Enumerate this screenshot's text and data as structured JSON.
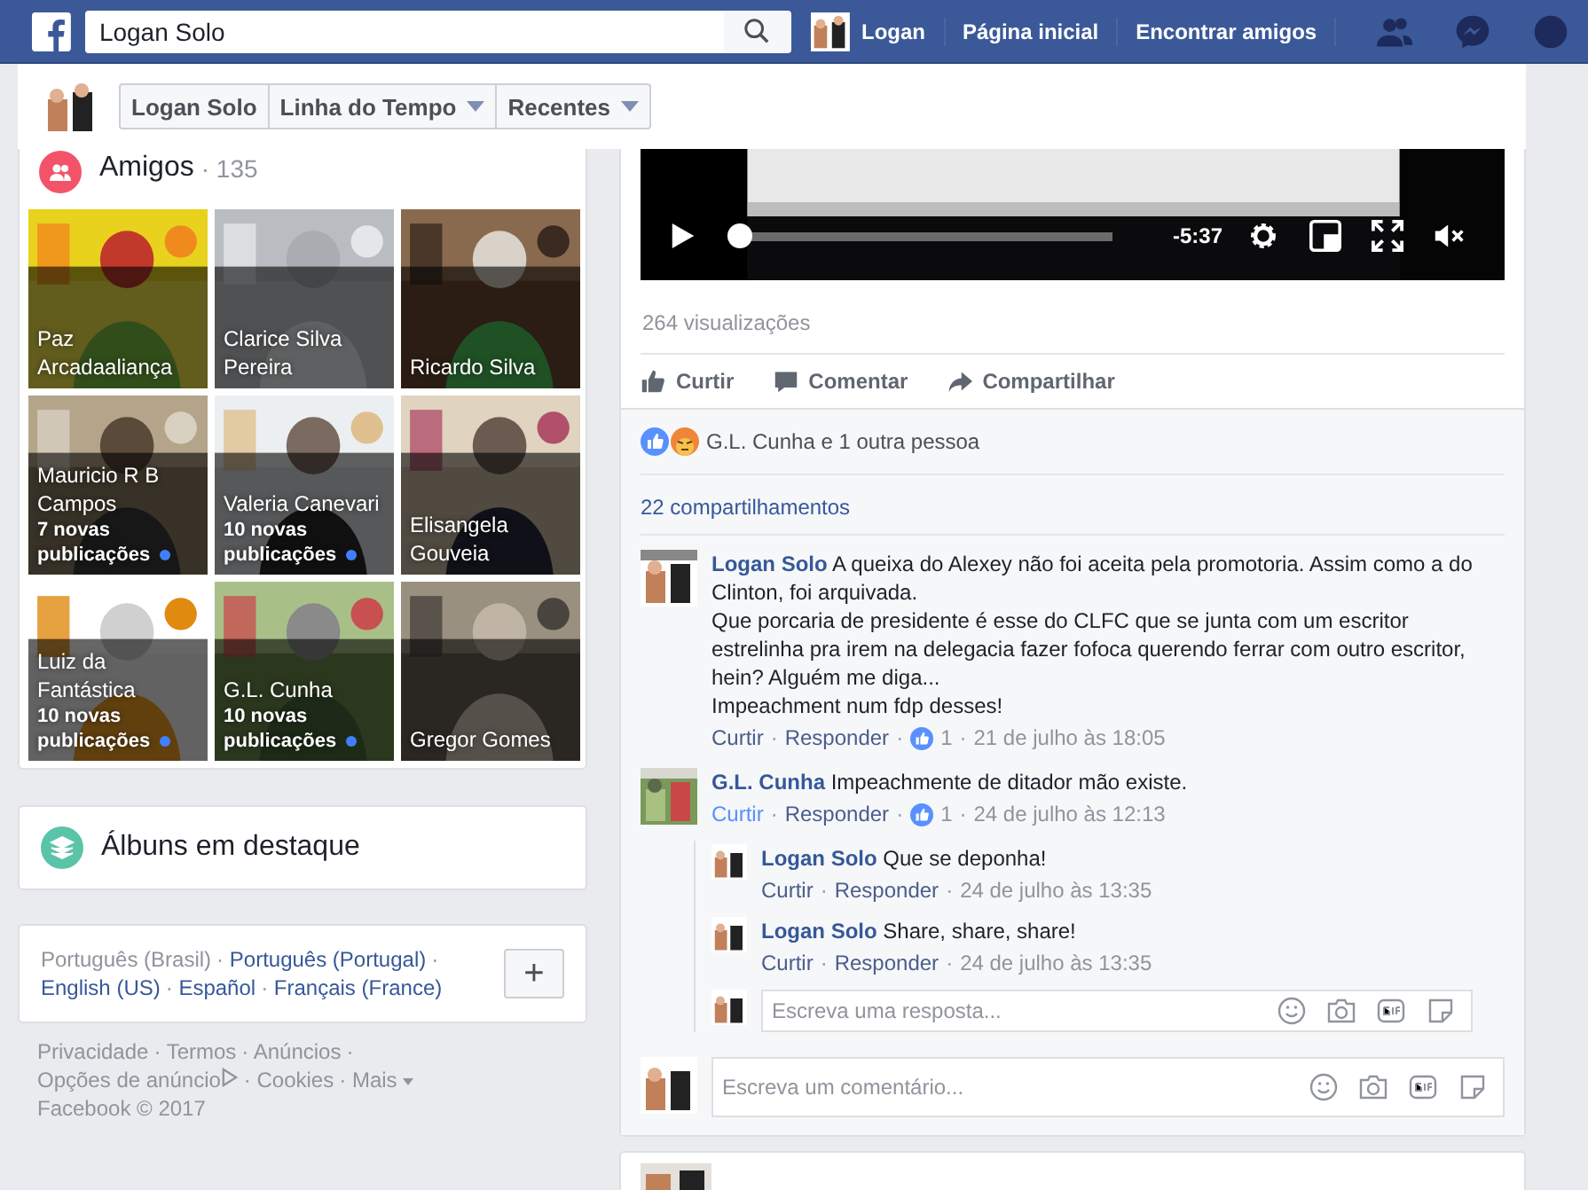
{
  "topbar": {
    "search": "Logan Solo",
    "user": "Logan",
    "nav": [
      "Página inicial",
      "Encontrar amigos"
    ]
  },
  "profile_nav": {
    "name": "Logan Solo",
    "menus": [
      "Linha do Tempo",
      "Recentes"
    ]
  },
  "friends": {
    "title": "Amigos",
    "count": "· 135",
    "tiles": [
      {
        "name": "Paz Arcadaaliança"
      },
      {
        "name": "Clarice Silva Pereira"
      },
      {
        "name": "Ricardo Silva"
      },
      {
        "name": "Mauricio R B Campos",
        "posts": "7 novas publicações"
      },
      {
        "name": "Valeria Canevari",
        "posts": "10 novas publicações"
      },
      {
        "name": "Elisangela Gouveia"
      },
      {
        "name": "Luiz da Fantástica",
        "posts": "10 novas publicações"
      },
      {
        "name": "G.L. Cunha",
        "posts": "10 novas publicações"
      },
      {
        "name": "Gregor Gomes"
      }
    ]
  },
  "albums": {
    "title": "Álbuns em destaque"
  },
  "languages": {
    "separator": "·",
    "add": "+",
    "items": [
      {
        "label": "Português (Brasil)",
        "selected": true
      },
      {
        "label": "Português (Portugal)",
        "selected": false
      },
      {
        "label": "English (US)",
        "selected": false
      },
      {
        "label": "Español",
        "selected": false
      },
      {
        "label": "Français (France)",
        "selected": false
      }
    ]
  },
  "footer": {
    "separator": "·",
    "links": [
      "Privacidade",
      "Termos",
      "Anúncios",
      "Opções de anúncio",
      "Cookies",
      "Mais"
    ],
    "copyright": "Facebook © 2017"
  },
  "post": {
    "video": {
      "time": "-5:37",
      "level": 0.01
    },
    "views": "264 visualizações",
    "actions": [
      "Curtir",
      "Comentar",
      "Compartilhar"
    ],
    "reactions": "G.L. Cunha e 1 outra pessoa",
    "shares": "22 compartilhamentos",
    "separator": "·",
    "comments": [
      {
        "author": "Logan Solo",
        "text": "A queixa do Alexey não foi aceita pela promotoria. Assim como a do Clinton, foi arquivada.\nQue porcaria de presidente é esse do CLFC que se junta com um escritor estrelinha pra irem na delegacia fazer fofoca querendo ferrar com outro escritor, hein? Alguém me diga...\nImpeachment num fdp desses!",
        "actions": [
          "Curtir",
          "Responder"
        ],
        "liked": false,
        "likes": "1",
        "time": "21 de julho às 18:05"
      },
      {
        "author": "G.L. Cunha",
        "text": "Impeachmente de ditador mão existe.",
        "actions": [
          "Curtir",
          "Responder"
        ],
        "liked": true,
        "likes": "1",
        "time": "24 de julho às 12:13",
        "reply_placeholder": "Escreva uma resposta...",
        "replies": [
          {
            "author": "Logan Solo",
            "text": "Que se deponha!",
            "actions": [
              "Curtir",
              "Responder"
            ],
            "time": "24 de julho às 13:35"
          },
          {
            "author": "Logan Solo",
            "text": "Share, share, share!",
            "actions": [
              "Curtir",
              "Responder"
            ],
            "time": "24 de julho às 13:35"
          }
        ]
      }
    ],
    "comment_placeholder": "Escreva um comentário..."
  }
}
